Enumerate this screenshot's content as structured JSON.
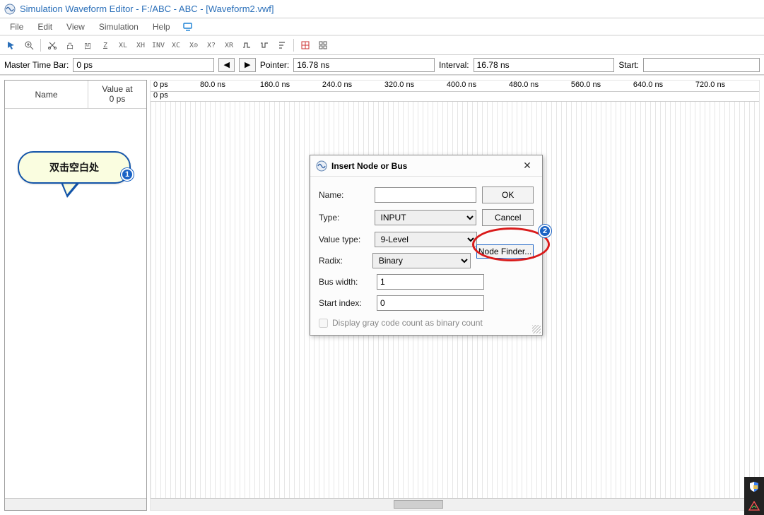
{
  "title": "Simulation Waveform Editor - F:/ABC - ABC - [Waveform2.vwf]",
  "menu": [
    "File",
    "Edit",
    "View",
    "Simulation",
    "Help"
  ],
  "toolbar_icons": [
    "pointer",
    "zoom",
    "x-cut",
    "low0",
    "high1",
    "z",
    "low",
    "high",
    "inv",
    "xc",
    "overwrite",
    "search",
    "rand",
    "group",
    "ungroup",
    "sort",
    "grid",
    "snap"
  ],
  "infobar": {
    "master_label": "Master Time Bar:",
    "master_value": "0 ps",
    "pointer_label": "Pointer:",
    "pointer_value": "16.78 ns",
    "interval_label": "Interval:",
    "interval_value": "16.78 ns",
    "start_label": "Start:",
    "start_value": ""
  },
  "name_col": "Name",
  "value_col": "Value at\n0 ps",
  "ruler": {
    "marks": [
      "0 ps",
      "80.0 ns",
      "160.0 ns",
      "240.0 ns",
      "320.0 ns",
      "400.0 ns",
      "480.0 ns",
      "560.0 ns",
      "640.0 ns",
      "720.0 ns"
    ],
    "sub": "0 ps"
  },
  "callout": {
    "text": "双击空白处",
    "step": "1"
  },
  "dialog": {
    "title": "Insert Node or Bus",
    "rows": {
      "name_lbl": "Name:",
      "name_val": "",
      "type_lbl": "Type:",
      "type_val": "INPUT",
      "vtype_lbl": "Value type:",
      "vtype_val": "9-Level",
      "radix_lbl": "Radix:",
      "radix_val": "Binary",
      "bwidth_lbl": "Bus width:",
      "bwidth_val": "1",
      "sidx_lbl": "Start index:",
      "sidx_val": "0"
    },
    "ok": "OK",
    "cancel": "Cancel",
    "nodefinder": "Node Finder...",
    "chk": "Display gray code count as binary count",
    "step": "2"
  }
}
